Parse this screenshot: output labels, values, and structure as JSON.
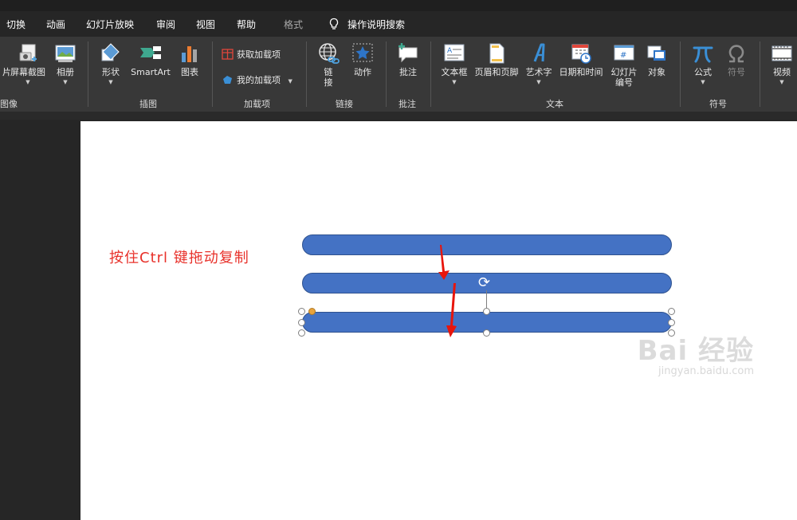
{
  "tabs": [
    {
      "label": "切换"
    },
    {
      "label": "动画"
    },
    {
      "label": "幻灯片放映"
    },
    {
      "label": "审阅"
    },
    {
      "label": "视图"
    },
    {
      "label": "帮助"
    },
    {
      "label": "格式"
    }
  ],
  "tell_me": {
    "label": "操作说明搜索"
  },
  "ribbon": {
    "picture_partial": "片",
    "screenshot": "屏幕截图",
    "album": "相册",
    "group_image_partial": "图像",
    "shapes": "形状",
    "smartart": "SmartArt",
    "chart": "图表",
    "group_illustrations": "插图",
    "get_addins": "获取加载项",
    "my_addins": "我的加载项",
    "group_addins": "加载项",
    "link": "链接",
    "action": "动作",
    "group_links": "链接",
    "comment": "批注",
    "group_comments": "批注",
    "textbox": "文本框",
    "header_footer": "页眉和页脚",
    "wordart": "艺术字",
    "datetime": "日期和时间",
    "slide_number_line1": "幻灯片",
    "slide_number_line2": "编号",
    "object": "对象",
    "group_text": "文本",
    "equation": "公式",
    "symbol": "符号",
    "group_symbols": "符号",
    "video": "视频"
  },
  "slide": {
    "instruction": "按住Ctrl  键拖动复制"
  },
  "watermark": {
    "line1": "Bai 经验",
    "line2": "jingyan.baidu.com"
  },
  "colors": {
    "accent_shape": "#4472c4",
    "instruction_red": "#e8312a",
    "ribbon_bg": "#383838"
  }
}
